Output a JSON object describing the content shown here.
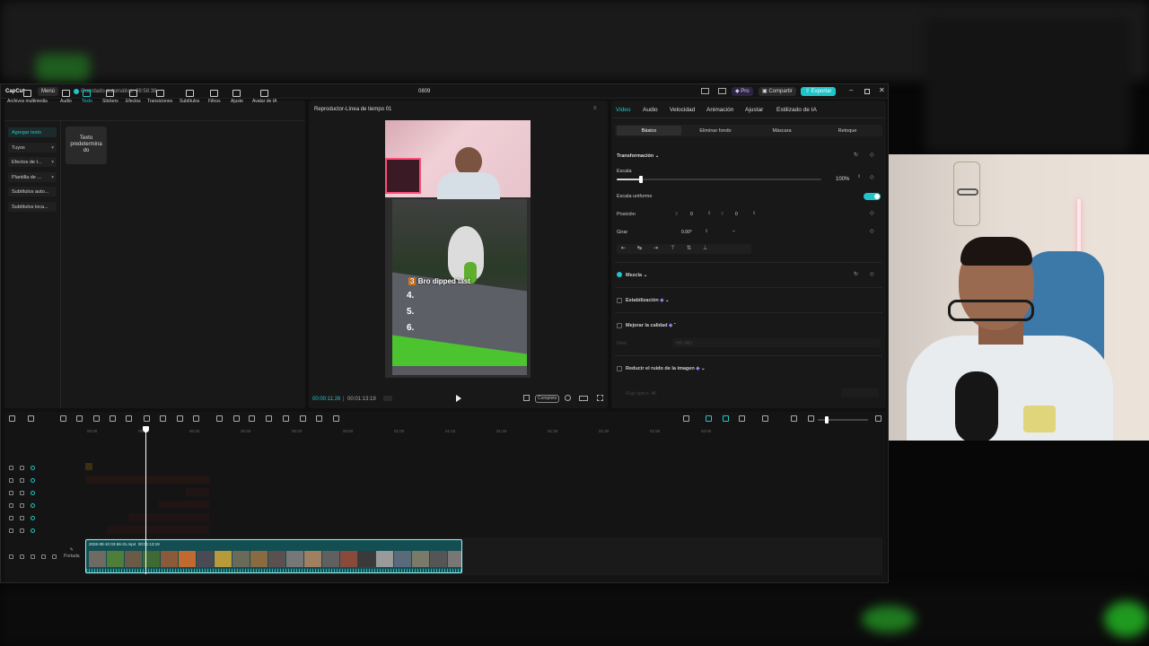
{
  "app": {
    "logo": "CapCut",
    "menu_label": "Menú",
    "autosave": "Guardado automático: 09:58:38",
    "project_name": "0809",
    "pro_label": "Pro",
    "share_label": "Compartir",
    "export_label": "Exportar"
  },
  "toolbar": {
    "items": [
      {
        "label": "Archivos multimedia",
        "icon": "media-icon"
      },
      {
        "label": "Audio",
        "icon": "audio-icon"
      },
      {
        "label": "Texto",
        "icon": "text-icon"
      },
      {
        "label": "Stickers",
        "icon": "sticker-icon"
      },
      {
        "label": "Efectos",
        "icon": "effects-icon"
      },
      {
        "label": "Transiciones",
        "icon": "transition-icon"
      },
      {
        "label": "Subtítulos",
        "icon": "subtitles-icon"
      },
      {
        "label": "Filtros",
        "icon": "filter-icon"
      },
      {
        "label": "Ajuste",
        "icon": "adjust-icon"
      },
      {
        "label": "Avatar de IA",
        "icon": "avatar-icon"
      }
    ],
    "active": "Texto"
  },
  "text_panel": {
    "categories": [
      "Agregar texto",
      "Tuyos",
      "Efectos de t...",
      "Plantilla de ...",
      "Subtítulos auto...",
      "Subtítulos loca..."
    ],
    "default_card": "Texto predetermina do"
  },
  "player": {
    "title": "Reproductor-Línea de tiempo 01",
    "current_time": "00:00:11:26",
    "total_time": "00:01:13:19",
    "complete_label": "Completo",
    "overlay_text": "Bro dipped last",
    "overlay_number": "3",
    "list_items": [
      "4.",
      "5.",
      "6."
    ]
  },
  "inspector": {
    "tabs": [
      "Video",
      "Audio",
      "Velocidad",
      "Animación",
      "Ajustar",
      "Estilizado de IA"
    ],
    "active_tab": "Video",
    "subtabs": [
      "Básico",
      "Eliminar fondo",
      "Máscara",
      "Retoque"
    ],
    "active_subtab": "Básico",
    "transform_label": "Transformación",
    "scale_label": "Escala",
    "scale_value": "100%",
    "scale_fraction": 0.12,
    "uniform_label": "Escala uniforme",
    "position_label": "Posición",
    "pos_x_label": "X",
    "pos_x": "0",
    "pos_y_label": "Y",
    "pos_y": "0",
    "rotate_label": "Girar",
    "rotate_value": "0.00°",
    "rotate_extra": "–",
    "blend_label": "Mezcla",
    "stabilize_label": "Estabilización",
    "enhance_label": "Mejorar la calidad",
    "enhance_sub_label": "Nivel",
    "enhance_sub_value": "HD (4K)",
    "denoise_label": "Reducir el ruido de la imagen",
    "denoise_sub": "Flujo óptico, 4K",
    "accent_color": "#20c5c9"
  },
  "timeline": {
    "ticks": [
      "00:00",
      "00:10",
      "00:20",
      "00:30",
      "00:40",
      "00:50",
      "01:00",
      "01:10",
      "01:20",
      "01:30",
      "01:40",
      "01:50",
      "02:00"
    ],
    "clip_name": "2026-08-10 03-56-31.mp4",
    "clip_duration": "00:01:13:19",
    "cover_label": "Portada",
    "playhead_time": "00:11"
  }
}
